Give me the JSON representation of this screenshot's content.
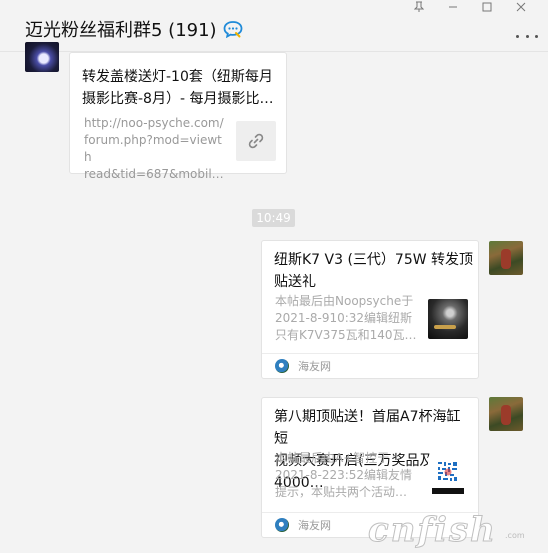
{
  "header": {
    "title": "迈光粉丝福利群5 (191)",
    "window_controls": [
      "pin-icon",
      "minimize-icon",
      "maximize-icon",
      "close-icon"
    ]
  },
  "messages": {
    "link_card": {
      "title_line1": "转发盖楼送灯-10套（纽斯每月",
      "title_line2": "摄影比赛-8月）- 每月摄影比…",
      "url_line1": "http://noo-psyche.com/",
      "url_line2": "forum.php?mod=viewth",
      "url_line3": "read&tid=687&mobil…"
    },
    "time_divider": "10:49",
    "article1": {
      "title_line1": "纽斯K7 V3 (三代）75W 转发顶",
      "title_line2": "贴送礼",
      "desc_line1": "本帖最后由Noopsyche于",
      "desc_line2": "2021-8-910:32编辑纽斯",
      "desc_line3": "只有K7V375瓦和140瓦…",
      "source": "海友网"
    },
    "article2": {
      "title_line1": "第八期顶贴送！首届A7杯海缸短",
      "title_line2": "视频大赛开启(三万奖品及4000…",
      "desc_line1": "本帖最后由A+智控于",
      "desc_line2": "2021-8-223:52编辑友情",
      "desc_line3": "提示，本贴共两个活动…",
      "source": "海友网"
    }
  },
  "watermark": {
    "main": "cnfish",
    "sub": ".com"
  },
  "colors": {
    "background": "#f3f3f3",
    "card": "#ffffff",
    "time_pill": "#dadada",
    "muted_text": "#999999"
  }
}
